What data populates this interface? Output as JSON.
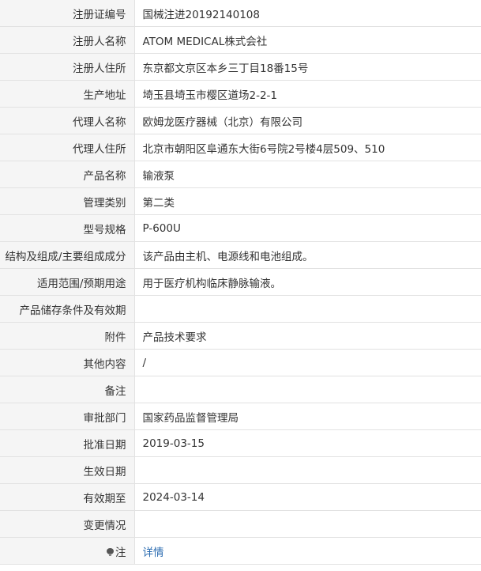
{
  "rows": [
    {
      "label": "注册证编号",
      "value": "国械注进20192140108"
    },
    {
      "label": "注册人名称",
      "value": "ATOM MEDICAL株式会社"
    },
    {
      "label": "注册人住所",
      "value": "东京都文京区本乡三丁目18番15号"
    },
    {
      "label": "生产地址",
      "value": "埼玉县埼玉市樱区道场2-2-1"
    },
    {
      "label": "代理人名称",
      "value": "欧姆龙医疗器械（北京）有限公司"
    },
    {
      "label": "代理人住所",
      "value": "北京市朝阳区阜通东大街6号院2号楼4层509、510"
    },
    {
      "label": "产品名称",
      "value": "输液泵"
    },
    {
      "label": "管理类别",
      "value": "第二类"
    },
    {
      "label": "型号规格",
      "value": "P-600U"
    },
    {
      "label": "结构及组成/主要组成成分",
      "value": "该产品由主机、电源线和电池组成。"
    },
    {
      "label": "适用范围/预期用途",
      "value": "用于医疗机构临床静脉输液。"
    },
    {
      "label": "产品储存条件及有效期",
      "value": ""
    },
    {
      "label": "附件",
      "value": "产品技术要求"
    },
    {
      "label": "其他内容",
      "value": "/"
    },
    {
      "label": "备注",
      "value": ""
    },
    {
      "label": "审批部门",
      "value": "国家药品监督管理局"
    },
    {
      "label": "批准日期",
      "value": "2019-03-15"
    },
    {
      "label": "生效日期",
      "value": ""
    },
    {
      "label": "有效期至",
      "value": "2024-03-14"
    },
    {
      "label": "变更情况",
      "value": ""
    }
  ],
  "note_row": {
    "label": "注",
    "icon": "lightbulb-icon",
    "link_text": "详情"
  }
}
